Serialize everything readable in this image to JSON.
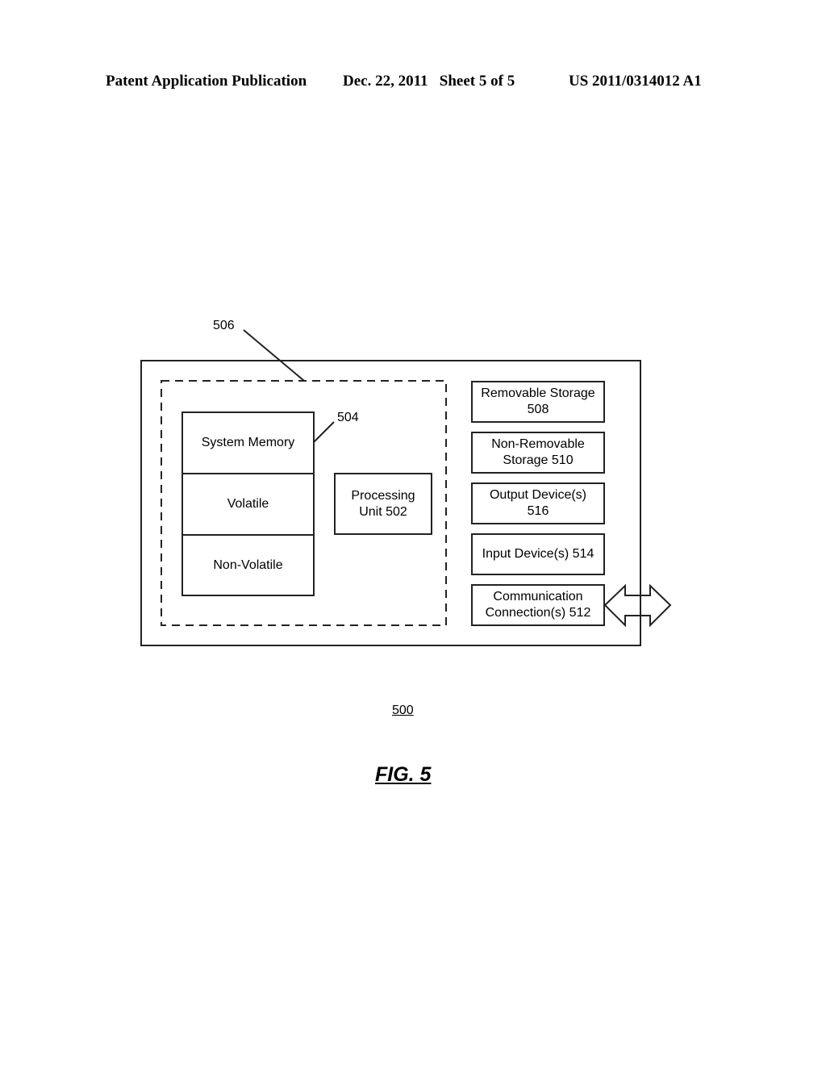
{
  "header": {
    "publication": "Patent Application Publication",
    "date_sheet": "Dec. 22, 2011   Sheet 5 of 5",
    "number": "US 2011/0314012 A1"
  },
  "diagram": {
    "ref_outer": "500",
    "ref_dashed": "506",
    "ref_memory": "504",
    "memory": {
      "title": "System Memory",
      "volatile": "Volatile",
      "non_volatile": "Non-Volatile"
    },
    "processing_unit": "Processing Unit 502",
    "right_boxes": [
      {
        "label": "Removable Storage 508"
      },
      {
        "label": "Non-Removable Storage 510"
      },
      {
        "label": "Output Device(s) 516"
      },
      {
        "label": "Input Device(s) 514"
      },
      {
        "label": "Communication Connection(s) 512"
      }
    ]
  },
  "figure_label": "FIG. 5"
}
